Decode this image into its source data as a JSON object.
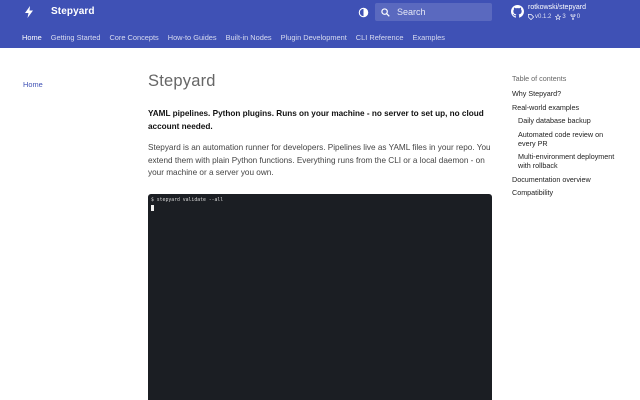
{
  "header": {
    "site_title": "Stepyard",
    "search_placeholder": "Search",
    "repo": {
      "name": "rotkowski/stepyard",
      "version": "v0.1.2",
      "stars": "3",
      "forks": "0"
    },
    "tabs": [
      {
        "label": "Home",
        "active": true
      },
      {
        "label": "Getting Started"
      },
      {
        "label": "Core Concepts"
      },
      {
        "label": "How-to Guides"
      },
      {
        "label": "Built-in Nodes"
      },
      {
        "label": "Plugin Development"
      },
      {
        "label": "CLI Reference"
      },
      {
        "label": "Examples"
      }
    ]
  },
  "leftnav": {
    "home_label": "Home"
  },
  "main": {
    "title": "Stepyard",
    "lead": "YAML pipelines. Python plugins. Runs on your machine - no server to set up, no cloud account needed.",
    "paragraph": "Stepyard is an automation runner for developers. Pipelines live as YAML files in your repo. You extend them with plain Python functions. Everything runs from the CLI or a local daemon - on your machine or a server you own.",
    "terminal_command": "$ stepyard validate --all"
  },
  "toc": {
    "title": "Table of contents",
    "items": [
      {
        "label": "Why Stepyard?",
        "level": 1
      },
      {
        "label": "Real-world examples",
        "level": 1
      },
      {
        "label": "Daily database backup",
        "level": 2
      },
      {
        "label": "Automated code review on every PR",
        "level": 2
      },
      {
        "label": "Multi-environment deployment with rollback",
        "level": 2
      },
      {
        "label": "Documentation overview",
        "level": 1
      },
      {
        "label": "Compatibility",
        "level": 1
      }
    ]
  },
  "colors": {
    "primary": "#3f51b5",
    "terminal_bg": "#1b1e23"
  },
  "icons": [
    "bolt-icon",
    "theme-toggle-icon",
    "search-icon",
    "github-icon",
    "tag-icon",
    "star-icon",
    "fork-icon"
  ]
}
